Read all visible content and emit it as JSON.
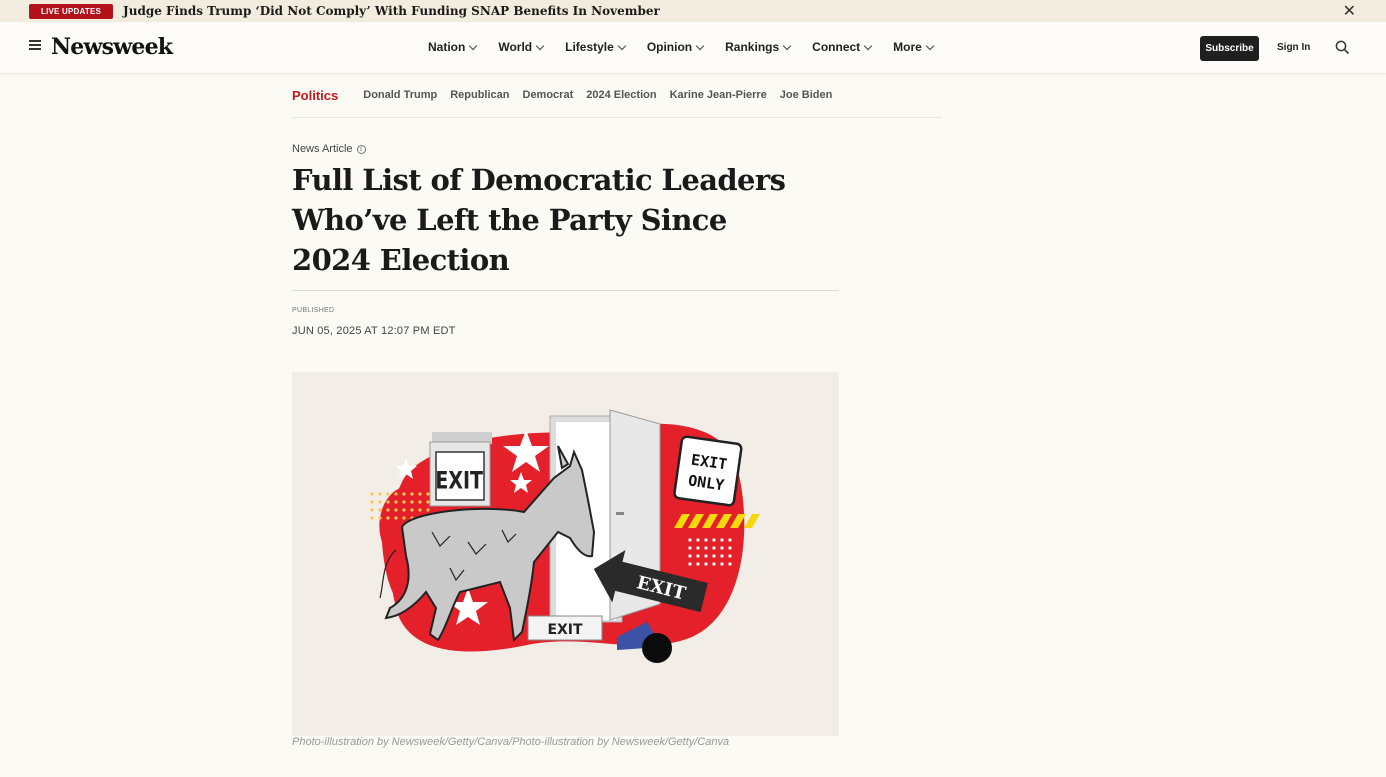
{
  "live_banner": {
    "badge": "LIVE UPDATES",
    "headline": "Judge Finds Trump ‘Did Not Comply’ With Funding SNAP Benefits In November",
    "close_icon": "close-icon"
  },
  "header": {
    "logo": "Newsweek",
    "nav": [
      {
        "label": "Nation"
      },
      {
        "label": "World"
      },
      {
        "label": "Lifestyle"
      },
      {
        "label": "Opinion"
      },
      {
        "label": "Rankings"
      },
      {
        "label": "Connect"
      },
      {
        "label": "More"
      }
    ],
    "subscribe": "Subscribe",
    "signin": "Sign In"
  },
  "subnav": {
    "section": "Politics",
    "tags": [
      "Donald Trump",
      "Republican",
      "Democrat",
      "2024 Election",
      "Karine Jean-Pierre",
      "Joe Biden"
    ]
  },
  "article": {
    "type": "News Article",
    "title": "Full List of Democratic Leaders Who’ve Left the Party Since 2024 Election",
    "published_label": "PUBLISHED",
    "published_date": "JUN 05, 2025 AT 12:07 PM EDT",
    "image": {
      "exit_sign": "EXIT",
      "exit_only_sign": "EXIT ONLY",
      "arrow_sign": "EXIT",
      "floor_sign": "EXIT"
    },
    "caption": "Photo-illustration by Newsweek/Getty/Canva/Photo-illustration by Newsweek/Getty/Canva"
  },
  "colors": {
    "accent_red": "#c8161d",
    "badge_red": "#b4121b",
    "banner_bg": "#f1ecdd",
    "page_bg": "#fbfaf5"
  }
}
